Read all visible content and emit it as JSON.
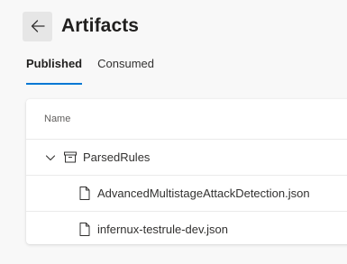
{
  "header": {
    "back_icon": "arrow-left-icon",
    "title": "Artifacts"
  },
  "tabs": [
    {
      "label": "Published",
      "active": true
    },
    {
      "label": "Consumed",
      "active": false
    }
  ],
  "table": {
    "columns": [
      "Name"
    ],
    "rows": [
      {
        "type": "folder",
        "icon": "artifact-folder-icon",
        "label": "ParsedRules",
        "expanded": true
      },
      {
        "type": "file",
        "icon": "file-icon",
        "label": "AdvancedMultistageAttackDetection.json"
      },
      {
        "type": "file",
        "icon": "file-icon",
        "label": "infernux-testrule-dev.json"
      }
    ]
  },
  "colors": {
    "accent": "#0078d4",
    "background": "#f8f8f8",
    "card": "#ffffff"
  }
}
